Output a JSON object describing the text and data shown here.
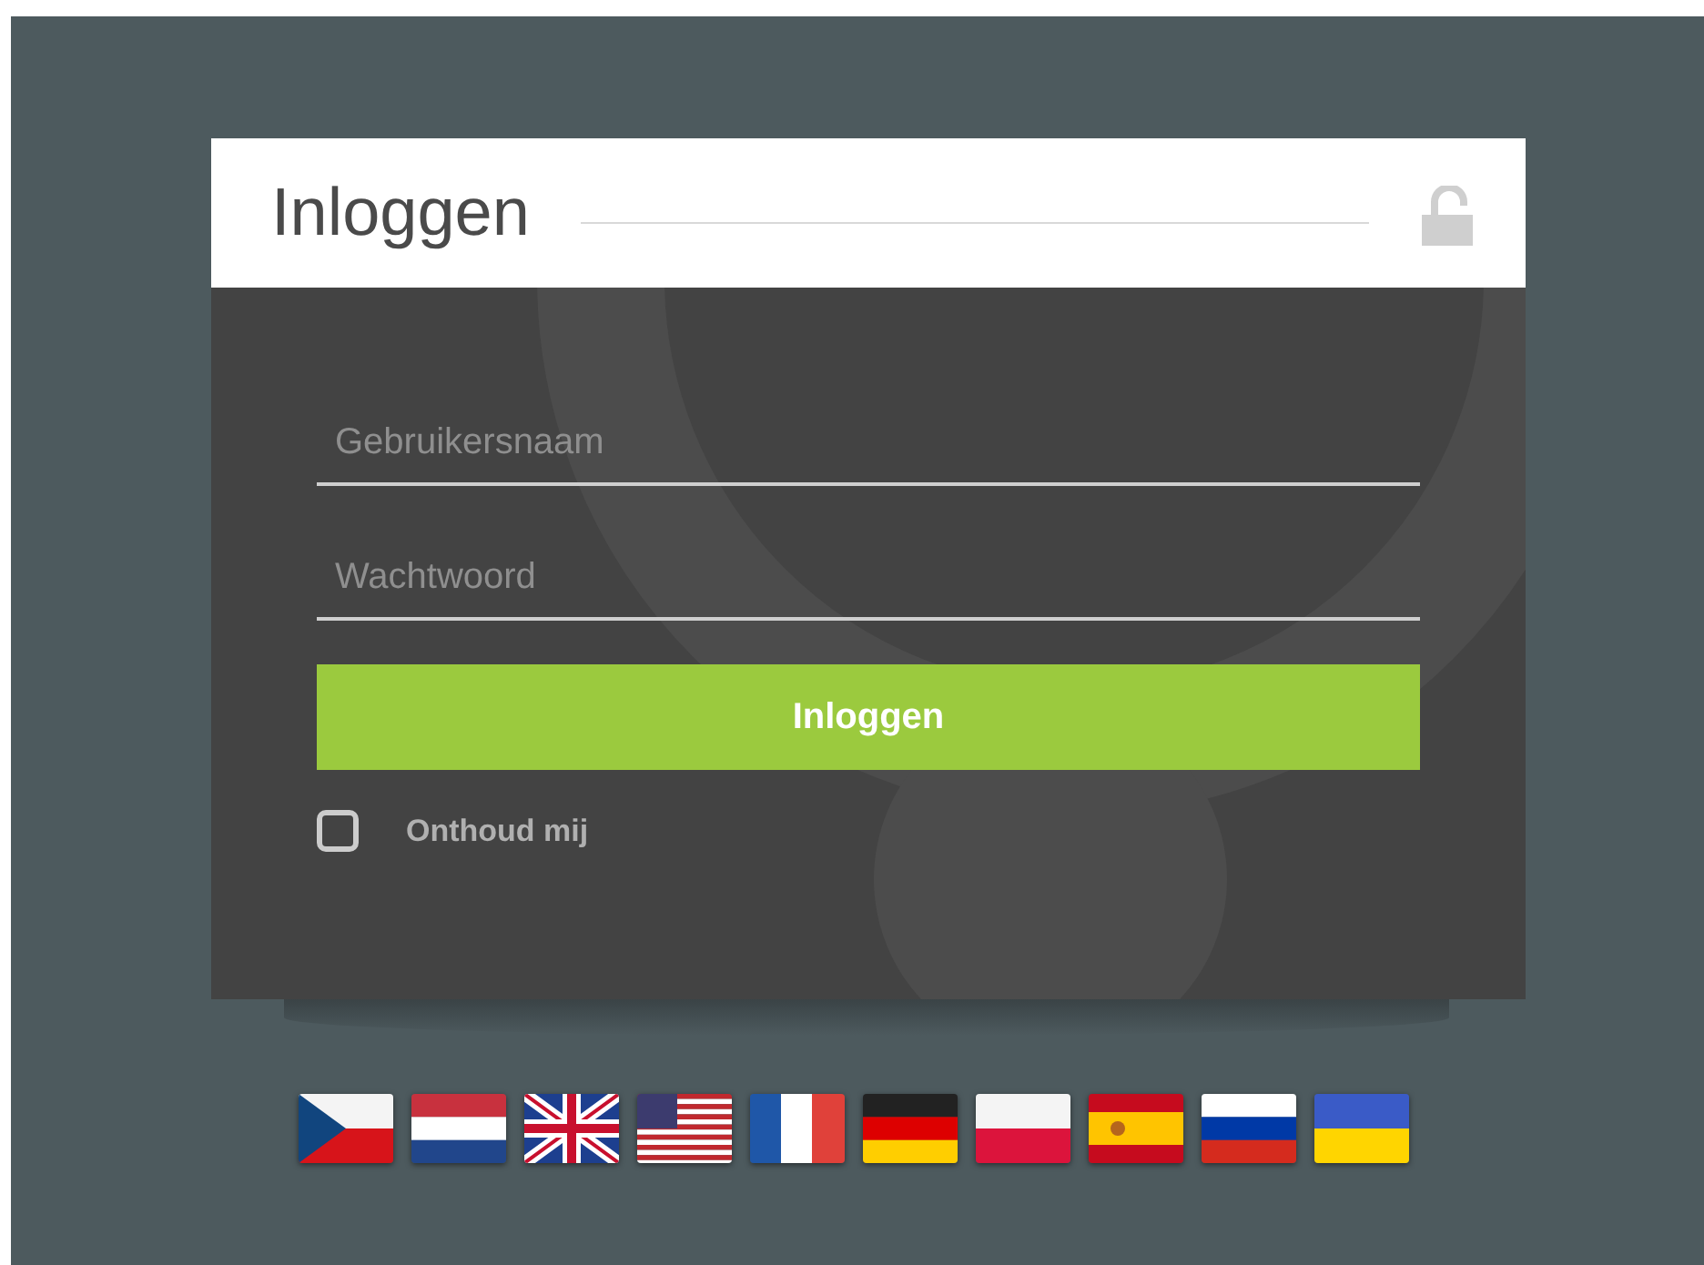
{
  "card": {
    "title": "Inloggen"
  },
  "fields": [
    {
      "placeholder": "Gebruikersnaam"
    },
    {
      "placeholder": "Wachtwoord"
    }
  ],
  "submit": "Inloggen",
  "remember": {
    "label": "Onthoud mij",
    "checked": false
  },
  "flags": [
    {
      "kind": "cz"
    },
    {
      "kind": "nl"
    },
    {
      "kind": "gb"
    },
    {
      "kind": "us"
    },
    {
      "kind": "fr"
    },
    {
      "kind": "de"
    },
    {
      "kind": "pl"
    },
    {
      "kind": "es"
    },
    {
      "kind": "ru"
    },
    {
      "kind": "ua"
    }
  ]
}
